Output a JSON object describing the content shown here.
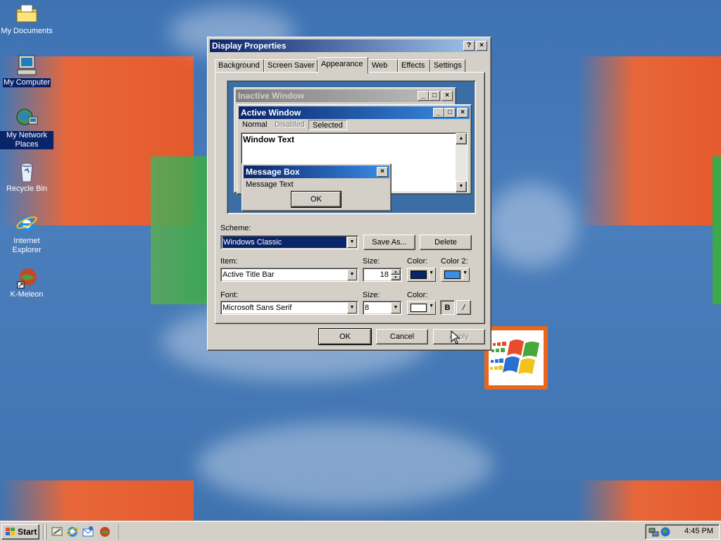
{
  "desktop_icons": [
    {
      "label": "My Documents",
      "icon": "folder-documents-icon"
    },
    {
      "label": "My Computer",
      "icon": "computer-icon"
    },
    {
      "label": "My Network Places",
      "icon": "network-places-icon"
    },
    {
      "label": "Recycle Bin",
      "icon": "recycle-bin-icon"
    },
    {
      "label": "Internet Explorer",
      "icon": "internet-explorer-icon"
    },
    {
      "label": "K-Meleon",
      "icon": "k-meleon-icon"
    }
  ],
  "dialog": {
    "title": "Display Properties",
    "help_button": "?",
    "close_button": "×",
    "tabs": [
      "Background",
      "Screen Saver",
      "Appearance",
      "Web",
      "Effects",
      "Settings"
    ],
    "active_tab": "Appearance",
    "preview": {
      "inactive_title": "Inactive Window",
      "active_title": "Active Window",
      "menu": [
        "Normal",
        "Disabled",
        "Selected"
      ],
      "window_text": "Window Text",
      "message_box_title": "Message Box",
      "message_text": "Message Text",
      "ok": "OK"
    },
    "scheme_label": "Scheme:",
    "scheme_value": "Windows Classic",
    "save_as": "Save As...",
    "delete": "Delete",
    "item_label": "Item:",
    "item_value": "Active Title Bar",
    "item_size_label": "Size:",
    "item_size_value": "18",
    "item_color_label": "Color:",
    "item_color2_label": "Color 2:",
    "item_color_hex": "#0a246a",
    "item_color2_hex": "#3a8ee6",
    "font_label": "Font:",
    "font_value": "Microsoft Sans Serif",
    "font_size_label": "Size:",
    "font_size_value": "8",
    "font_color_label": "Color:",
    "font_color_hex": "#ffffff",
    "bold": "B",
    "italic": "/",
    "ok": "OK",
    "cancel": "Cancel",
    "apply": "Apply"
  },
  "taskbar": {
    "start_label": "Start",
    "quick_launch": [
      "show-desktop-icon",
      "internet-explorer-icon",
      "outlook-express-icon",
      "k-meleon-icon"
    ],
    "clock": "4:45 PM"
  }
}
